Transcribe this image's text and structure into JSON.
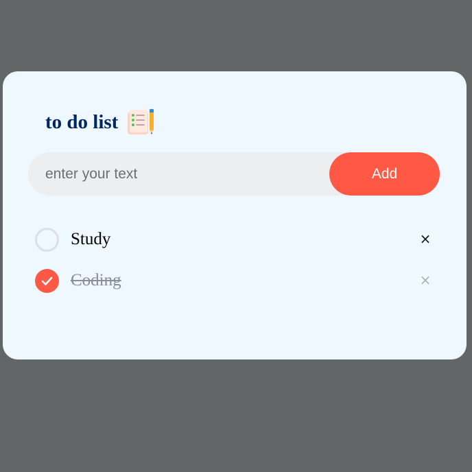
{
  "app": {
    "title": "to do list",
    "title_icon": "checklist-notepad-icon"
  },
  "input": {
    "placeholder": "enter your text",
    "value": ""
  },
  "add_button": {
    "label": "Add"
  },
  "tasks": [
    {
      "label": "Study",
      "done": false
    },
    {
      "label": "Coding",
      "done": true
    }
  ],
  "delete_glyph": "×",
  "colors": {
    "background": "#626667",
    "card": "#eff7ff",
    "accent": "#ff5945",
    "title": "#002765",
    "input_bg": "#edeef0"
  }
}
